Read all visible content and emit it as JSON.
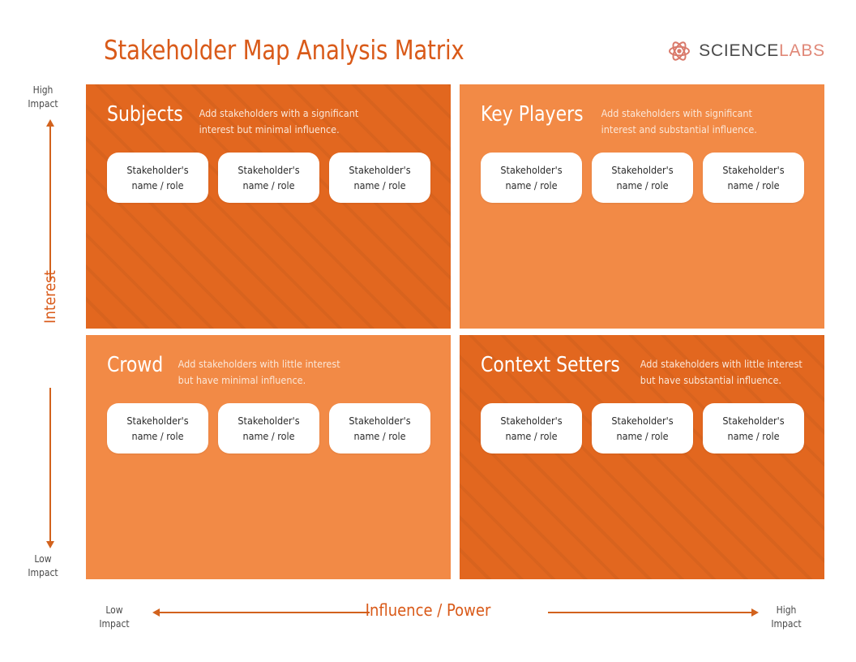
{
  "header": {
    "title": "Stakeholder Map Analysis Matrix",
    "logo": {
      "icon": "atom-icon",
      "word_primary": "SCIENCE",
      "word_secondary": "LABS"
    }
  },
  "colors": {
    "title": "#D95A19",
    "quadrant_dark": "#E2671F",
    "quadrant_light": "#F28A46",
    "card_bg": "#FFFFFF",
    "axis_line": "#D2621D",
    "axis_caption": "#4A4A4A",
    "logo_secondary": "#E08878"
  },
  "card_label": {
    "line1": "Stakeholder's",
    "line2": "name / role"
  },
  "quadrants": [
    {
      "key": "subjects",
      "title": "Subjects",
      "desc_line1": "Add stakeholders with a significant",
      "desc_line2": "interest but minimal influence.",
      "tone": "dark",
      "striped": true,
      "cards": 3
    },
    {
      "key": "key-players",
      "title": "Key Players",
      "desc_line1": "Add stakeholders with significant",
      "desc_line2": "interest and substantial influence.",
      "tone": "light",
      "striped": false,
      "cards": 3
    },
    {
      "key": "crowd",
      "title": "Crowd",
      "desc_line1": "Add stakeholders with little interest",
      "desc_line2": "but have minimal influence.",
      "tone": "light",
      "striped": false,
      "cards": 3
    },
    {
      "key": "context-setters",
      "title": "Context Setters",
      "desc_line1": "Add stakeholders with little interest",
      "desc_line2": "but have substantial influence.",
      "tone": "dark",
      "striped": true,
      "cards": 3
    }
  ],
  "axes": {
    "y": {
      "label": "Interest",
      "top_caption_line1": "High",
      "top_caption_line2": "Impact",
      "bottom_caption_line1": "Low",
      "bottom_caption_line2": "Impact"
    },
    "x": {
      "label": "Influence / Power",
      "left_caption_line1": "Low",
      "left_caption_line2": "Impact",
      "right_caption_line1": "High",
      "right_caption_line2": "Impact"
    }
  }
}
